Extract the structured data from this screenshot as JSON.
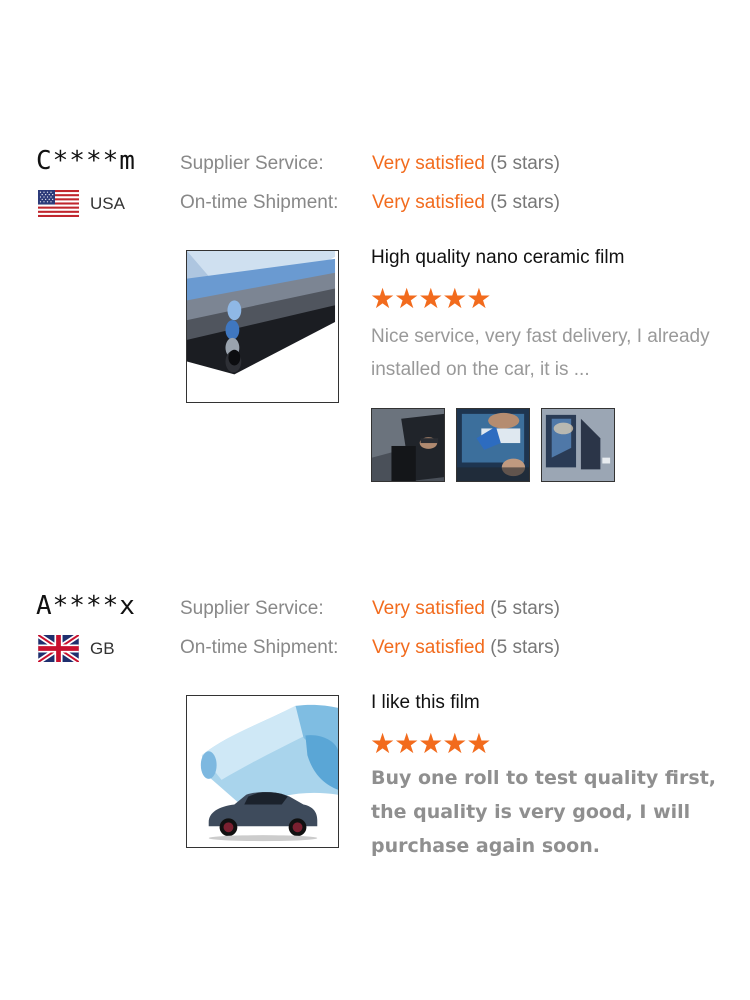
{
  "reviews": [
    {
      "user": "C****m",
      "country": "USA",
      "flag_icon": "us-flag-icon",
      "supplier_label": "Supplier Service:",
      "supplier_value": "Very satisfied",
      "supplier_stars": "(5 stars)",
      "shipment_label": "On-time Shipment:",
      "shipment_value": "Very satisfied",
      "shipment_stars": "(5 stars)",
      "title": "High quality nano ceramic film",
      "stars": "★★★★★",
      "rating": 5,
      "text": "Nice service, very fast delivery, I already installed on the car, it is ...",
      "photos": [
        "window-tint-install-photo",
        "window-tint-squeegee-photo",
        "tinted-car-window-photo"
      ]
    },
    {
      "user": "A****x",
      "country": "GB",
      "flag_icon": "gb-flag-icon",
      "supplier_label": "Supplier Service:",
      "supplier_value": "Very satisfied",
      "supplier_stars": "(5 stars)",
      "shipment_label": "On-time Shipment:",
      "shipment_value": "Very satisfied",
      "shipment_stars": "(5 stars)",
      "title": "I like this film",
      "stars": "★★★★★",
      "rating": 5,
      "text": "Buy one roll to test quality first, the quality is very good, I will purchase again soon."
    }
  ],
  "colors": {
    "accent": "#f26b1d",
    "label": "#888888",
    "muted_text": "#999999"
  }
}
